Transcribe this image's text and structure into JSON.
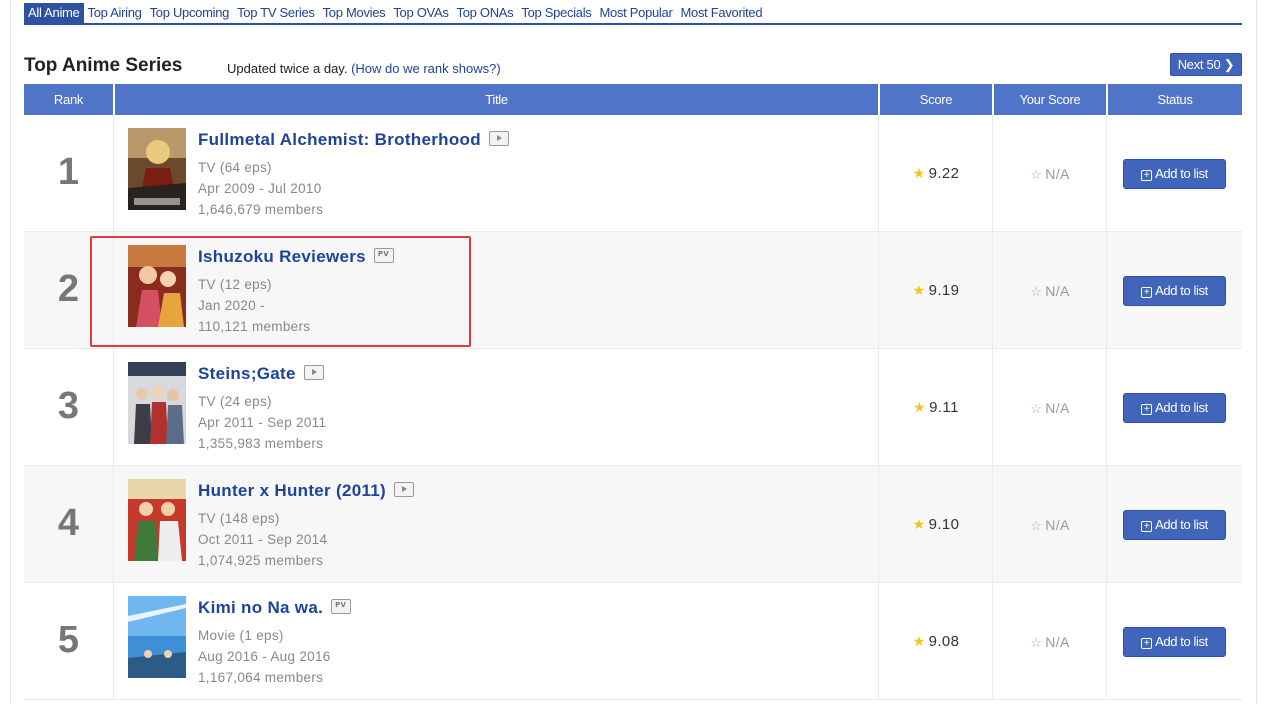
{
  "category_tabs": [
    {
      "label": "All Anime",
      "active": true
    },
    {
      "label": "Top Airing",
      "active": false
    },
    {
      "label": "Top Upcoming",
      "active": false
    },
    {
      "label": "Top TV Series",
      "active": false
    },
    {
      "label": "Top Movies",
      "active": false
    },
    {
      "label": "Top OVAs",
      "active": false
    },
    {
      "label": "Top ONAs",
      "active": false
    },
    {
      "label": "Top Specials",
      "active": false
    },
    {
      "label": "Most Popular",
      "active": false
    },
    {
      "label": "Most Favorited",
      "active": false
    }
  ],
  "header": {
    "title": "Top Anime Series",
    "updated_text": "Updated twice a day.",
    "rank_link_open": "(",
    "rank_link": "How do we rank shows?",
    "rank_link_close": ")",
    "next_label": "Next 50"
  },
  "columns": {
    "rank": "Rank",
    "title": "Title",
    "score": "Score",
    "your_score": "Your Score",
    "status": "Status"
  },
  "rows": [
    {
      "rank": "1",
      "title": "Fullmetal Alchemist: Brotherhood",
      "badge": "play-icon",
      "type": "TV (64 eps)",
      "dates": "Apr 2009 - Jul 2010",
      "members": "1,646,679 members",
      "score": "9.22",
      "your_score": "N/A",
      "add_label": "Add to list"
    },
    {
      "rank": "2",
      "title": "Ishuzoku Reviewers",
      "badge": "pv-icon",
      "type": "TV (12 eps)",
      "dates": "Jan 2020 -",
      "members": "110,121 members",
      "score": "9.19",
      "your_score": "N/A",
      "add_label": "Add to list"
    },
    {
      "rank": "3",
      "title": "Steins;Gate",
      "badge": "play-icon",
      "type": "TV (24 eps)",
      "dates": "Apr 2011 - Sep 2011",
      "members": "1,355,983 members",
      "score": "9.11",
      "your_score": "N/A",
      "add_label": "Add to list"
    },
    {
      "rank": "4",
      "title": "Hunter x Hunter (2011)",
      "badge": "play-icon",
      "type": "TV (148 eps)",
      "dates": "Oct 2011 - Sep 2014",
      "members": "1,074,925 members",
      "score": "9.10",
      "your_score": "N/A",
      "add_label": "Add to list"
    },
    {
      "rank": "5",
      "title": "Kimi no Na wa.",
      "badge": "pv-icon",
      "type": "Movie (1 eps)",
      "dates": "Aug 2016 - Aug 2016",
      "members": "1,167,064 members",
      "score": "9.08",
      "your_score": "N/A",
      "add_label": "Add to list"
    }
  ],
  "colors": {
    "accent": "#2e51a2",
    "header_bg": "#4f74c8",
    "link": "#1d439b",
    "highlight": "#e23b3b",
    "star": "#f5c518"
  }
}
